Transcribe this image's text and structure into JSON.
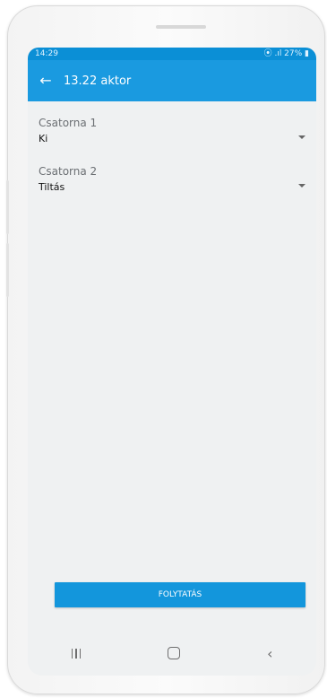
{
  "status": {
    "time": "14:29",
    "indicators": "⦿ .ıl 27% ▮"
  },
  "appbar": {
    "title": "13.22 aktor",
    "back_icon": "arrow-left-icon"
  },
  "fields": [
    {
      "label": "Csatorna 1",
      "value": "Ki"
    },
    {
      "label": "Csatorna 2",
      "value": "Tiltás"
    }
  ],
  "actions": {
    "continue_label": "FOLYTATÁS"
  },
  "colors": {
    "status_bar": "#0b8fd6",
    "app_bar": "#1a9ae0",
    "button": "#1396dc",
    "background": "#eff1f2"
  },
  "navbar": {
    "recents_icon": "recents-icon",
    "home_icon": "home-icon",
    "back_icon": "back-chevron-icon"
  }
}
